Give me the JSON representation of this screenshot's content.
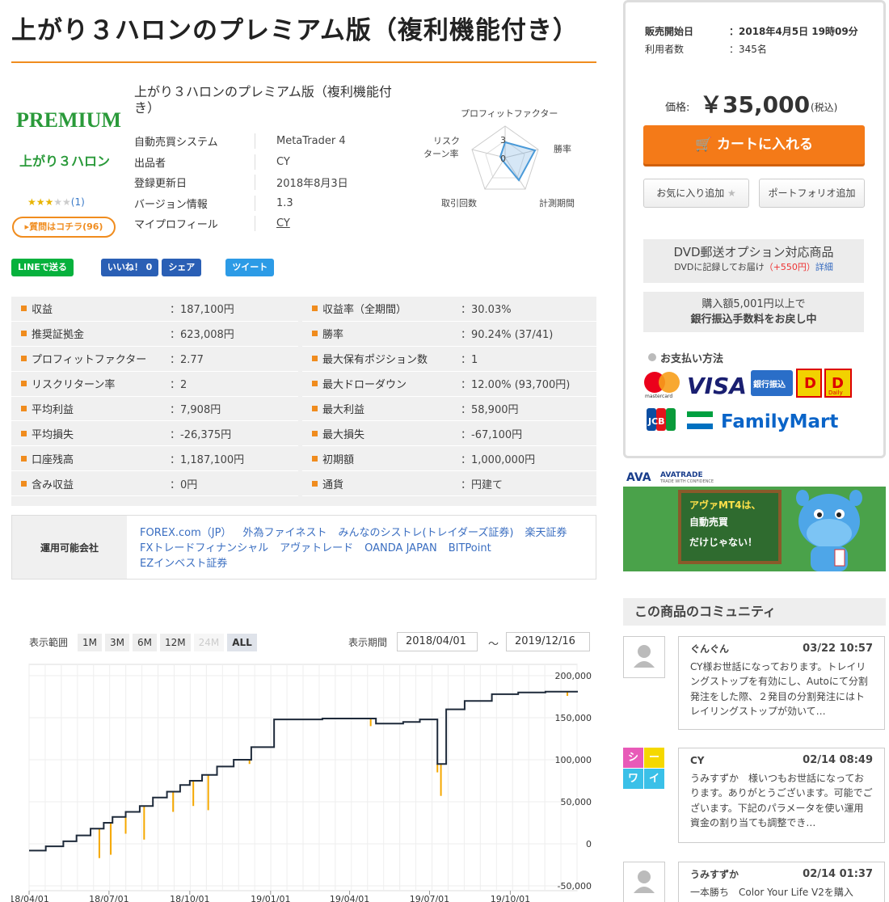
{
  "product": {
    "title": "上がり３ハロンのプレミアム版（複利機能付き）",
    "logo_premium": "PREMIUM",
    "logo_name": "上がり３ハロン",
    "rating_stars": "★★★",
    "rating_empty": "★★",
    "rating_count": "(1)",
    "question_button": "▸質問はコチラ(96)",
    "name_line": "上がり３ハロンのプレミアム版（複利機能付き）",
    "info": [
      {
        "key": "自動売買システム",
        "value": "MetaTrader 4"
      },
      {
        "key": "出品者",
        "value": "CY"
      },
      {
        "key": "登録更新日",
        "value": "2018年8月3日"
      },
      {
        "key": "バージョン情報",
        "value": "1.3"
      },
      {
        "key": "マイプロフィール",
        "value": "CY"
      }
    ]
  },
  "radar": {
    "labels": [
      "プロフィットファクター",
      "勝率",
      "計測期間",
      "取引回数",
      "リスク\nターン率"
    ],
    "label_top": "プロフィットファクター",
    "label_right": "勝率",
    "label_bottom_right": "計測期間",
    "label_bottom_left": "取引回数",
    "label_left_1": "リスク",
    "label_left_2": "ターン率",
    "scale_max": "3",
    "scale_zero": "0"
  },
  "social": {
    "line": "LINEで送る",
    "like": "いいね！ 0",
    "share": "シェア",
    "tweet": "ツイート"
  },
  "stats_left": [
    {
      "key": "収益",
      "value": "：187,100円"
    },
    {
      "key": "推奨証拠金",
      "value": "：623,008円"
    },
    {
      "key": "プロフィットファクター",
      "value": "：2.77"
    },
    {
      "key": "リスクリターン率",
      "value": "：2"
    },
    {
      "key": "平均利益",
      "value": "：7,908円"
    },
    {
      "key": "平均損失",
      "value": "：-26,375円"
    },
    {
      "key": "口座残高",
      "value": "：1,187,100円"
    },
    {
      "key": "含み収益",
      "value": "：0円"
    }
  ],
  "stats_right": [
    {
      "key": "収益率（全期間）",
      "value": "：30.03%"
    },
    {
      "key": "勝率",
      "value": "：90.24% (37/41)"
    },
    {
      "key": "最大保有ポジション数",
      "value": "：1"
    },
    {
      "key": "最大ドローダウン",
      "value": "：12.00% (93,700円)"
    },
    {
      "key": "最大利益",
      "value": "：58,900円"
    },
    {
      "key": "最大損失",
      "value": "：-67,100円"
    },
    {
      "key": "初期額",
      "value": "：1,000,000円"
    },
    {
      "key": "通貨",
      "value": "：円建て"
    }
  ],
  "brokers": {
    "label": "運用可能会社",
    "items": [
      "FOREX.com（JP）",
      "外為ファイネスト",
      "みんなのシストレ(トレイダーズ証券)",
      "楽天証券",
      "FXトレードフィナンシャル",
      "アヴァトレード",
      "OANDA JAPAN",
      "BITPoint",
      "EZインベスト証券"
    ]
  },
  "chart_controls": {
    "range_label": "表示範囲",
    "ranges": [
      "1M",
      "3M",
      "6M",
      "12M",
      "24M",
      "ALL"
    ],
    "period_label": "表示期間",
    "from": "2018/04/01",
    "tilde": "～",
    "to": "2019/12/16"
  },
  "chart_data": {
    "type": "line",
    "x_tick_labels": [
      "18/04/01",
      "18/07/01",
      "18/10/01",
      "19/01/01",
      "19/04/01",
      "19/07/01",
      "19/10/01"
    ],
    "y_tick_labels": [
      "200,000",
      "150,000",
      "100,000",
      "50,000",
      "0",
      "-50,000"
    ],
    "ylim": [
      -50000,
      200000
    ],
    "series": [
      {
        "color": "#1e2a3a",
        "x": [
          "2018-04-01",
          "2018-04-20",
          "2018-05-10",
          "2018-05-25",
          "2018-06-10",
          "2018-06-25",
          "2018-07-05",
          "2018-07-20",
          "2018-08-05",
          "2018-08-20",
          "2018-09-05",
          "2018-09-20",
          "2018-10-01",
          "2018-10-15",
          "2018-11-01",
          "2018-11-20",
          "2018-12-10",
          "2019-01-05",
          "2019-02-01",
          "2019-03-01",
          "2019-04-01",
          "2019-05-01",
          "2019-06-01",
          "2019-06-20",
          "2019-07-10",
          "2019-07-20",
          "2019-08-10",
          "2019-09-10",
          "2019-10-10",
          "2019-11-10",
          "2019-12-16"
        ],
        "values": [
          -8000,
          -3000,
          3000,
          10000,
          18000,
          25000,
          32000,
          38000,
          45000,
          55000,
          62000,
          70000,
          75000,
          82000,
          92000,
          100000,
          115000,
          148000,
          148000,
          149000,
          149000,
          143000,
          145000,
          148000,
          95000,
          160000,
          170000,
          178000,
          180000,
          181000,
          182000
        ]
      },
      {
        "color": "#f5a800",
        "name": "",
        "x": [
          "2018-06-20",
          "2018-07-03",
          "2018-07-20",
          "2018-08-10",
          "2018-09-12",
          "2018-10-05",
          "2018-10-22",
          "2018-12-08",
          "2019-04-25",
          "2019-07-10",
          "2019-07-14",
          "2019-12-05"
        ],
        "values": [
          -17000,
          -13000,
          12000,
          5000,
          38000,
          45000,
          40000,
          95000,
          140000,
          85000,
          57000,
          176000
        ]
      }
    ]
  },
  "sidebar": {
    "sale_start_label": "販売開始日",
    "sale_start_value": "：2018年4月5日 19時09分",
    "users_label": "利用者数",
    "users_value": "：345名",
    "price_label": "価格:",
    "price": "￥35,000",
    "price_tax": "(税込)",
    "cart_button": "カートに入れる",
    "fav_button": "お気に入り追加",
    "portfolio_button": "ポートフォリオ追加",
    "dvd_title": "DVD郵送オプション対応商品",
    "dvd_sub": "DVDに記録してお届け",
    "dvd_price": "（+550円）",
    "dvd_link": "詳細",
    "bank_line1": "購入額5,001円以上で",
    "bank_line2": "銀行振込手数料をお戻し中",
    "payment_label": "お支払い方法",
    "pay_visa": "VISA",
    "pay_bank": "銀行振込",
    "pay_mastercard": "mastercard",
    "pay_jcb": "JCB",
    "pay_familymart": "FamilyMart",
    "pay_daily": "Daily"
  },
  "ad": {
    "brand": "AVATRADE",
    "brand_sub": "TRADE WITH CONFIDENCE",
    "line1": "アヴァMT4は、",
    "line2": "自動売買",
    "line3": "だけじゃない！"
  },
  "community": {
    "heading": "この商品のコミュニティ",
    "posts": [
      {
        "author": "ぐんぐん",
        "date": "03/22 10:57",
        "text": "CY様お世話になっております。トレイリングストップを有効にし、Autoにて分割発注をした際、２発目の分割発注にはトレイリングストップが効いて…"
      },
      {
        "author": "CY",
        "date": "02/14 08:49",
        "text": "うみすずか　様いつもお世話になっております。ありがとうございます。可能でございます。下記のパラメータを使い運用資金の割り当ても調整でき…"
      },
      {
        "author": "うみすずか",
        "date": "02/14 01:37",
        "text": "一本勝ち　Color Your Life V2を購入"
      }
    ],
    "cy_avatar": [
      "シ",
      "ー",
      "ワ",
      "イ"
    ]
  }
}
